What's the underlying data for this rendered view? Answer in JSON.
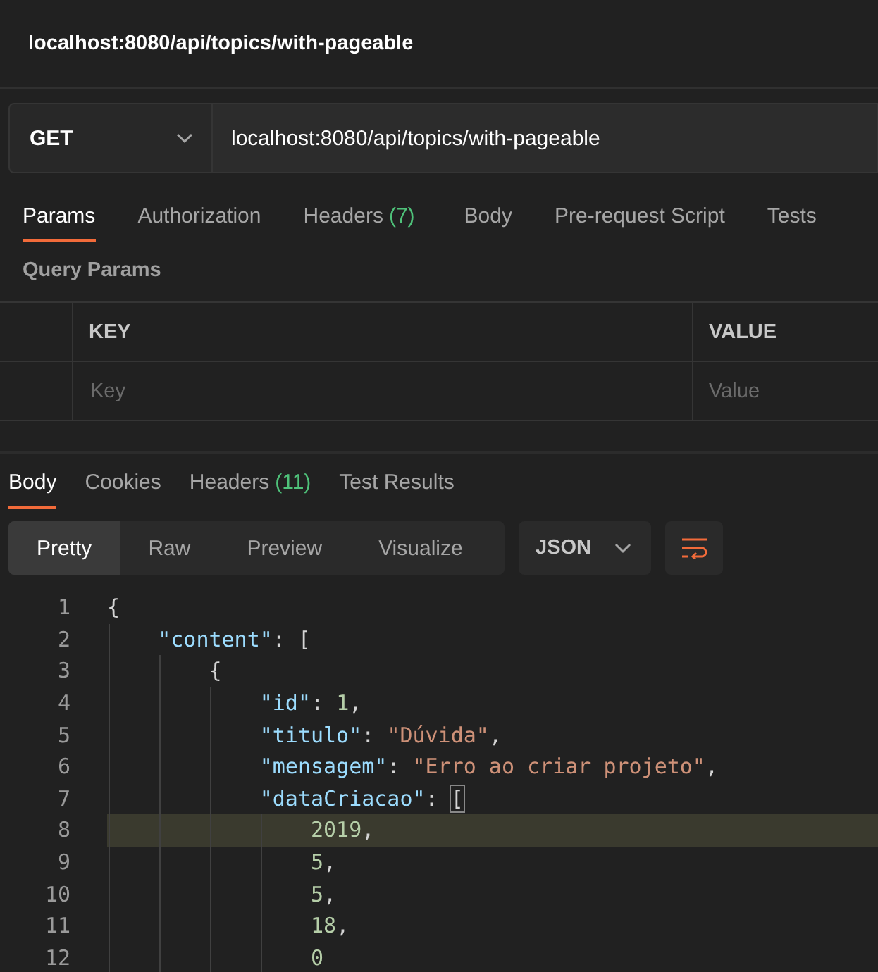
{
  "title": "localhost:8080/api/topics/with-pageable",
  "request": {
    "method": "GET",
    "url": "localhost:8080/api/topics/with-pageable"
  },
  "request_tabs": [
    {
      "label": "Params",
      "selected": true
    },
    {
      "label": "Authorization",
      "selected": false
    },
    {
      "label": "Headers",
      "count": "(7)",
      "selected": false
    },
    {
      "label": "Body",
      "selected": false
    },
    {
      "label": "Pre-request Script",
      "selected": false
    },
    {
      "label": "Tests",
      "selected": false
    }
  ],
  "query_params": {
    "heading": "Query Params",
    "columns": [
      "KEY",
      "VALUE"
    ],
    "placeholders": [
      "Key",
      "Value"
    ]
  },
  "response_tabs": [
    {
      "label": "Body",
      "selected": true
    },
    {
      "label": "Cookies",
      "selected": false
    },
    {
      "label": "Headers",
      "count": "(11)",
      "selected": false
    },
    {
      "label": "Test Results",
      "selected": false
    }
  ],
  "view_modes": [
    {
      "label": "Pretty",
      "selected": true
    },
    {
      "label": "Raw",
      "selected": false
    },
    {
      "label": "Preview",
      "selected": false
    },
    {
      "label": "Visualize",
      "selected": false
    }
  ],
  "format": "JSON",
  "code": [
    {
      "number": "1",
      "highlighted": false,
      "tokens": [
        {
          "kind": "punct",
          "text": "{"
        }
      ]
    },
    {
      "number": "2",
      "highlighted": false,
      "tokens": [
        {
          "kind": "key",
          "text": "    \"content\""
        },
        {
          "kind": "punct",
          "text": ": ["
        }
      ]
    },
    {
      "number": "3",
      "highlighted": false,
      "tokens": [
        {
          "kind": "punct",
          "text": "        {"
        }
      ]
    },
    {
      "number": "4",
      "highlighted": false,
      "tokens": [
        {
          "kind": "key",
          "text": "            \"id\""
        },
        {
          "kind": "punct",
          "text": ": "
        },
        {
          "kind": "number",
          "text": "1"
        },
        {
          "kind": "punct",
          "text": ","
        }
      ]
    },
    {
      "number": "5",
      "highlighted": false,
      "tokens": [
        {
          "kind": "key",
          "text": "            \"titulo\""
        },
        {
          "kind": "punct",
          "text": ": "
        },
        {
          "kind": "string",
          "text": "\"Dúvida\""
        },
        {
          "kind": "punct",
          "text": ","
        }
      ]
    },
    {
      "number": "6",
      "highlighted": false,
      "tokens": [
        {
          "kind": "key",
          "text": "            \"mensagem\""
        },
        {
          "kind": "punct",
          "text": ": "
        },
        {
          "kind": "string",
          "text": "\"Erro ao criar projeto\""
        },
        {
          "kind": "punct",
          "text": ","
        }
      ]
    },
    {
      "number": "7",
      "highlighted": false,
      "tokens": [
        {
          "kind": "key",
          "text": "            \"dataCriacao\""
        },
        {
          "kind": "punct",
          "text": ": "
        },
        {
          "kind": "match",
          "text": "["
        }
      ]
    },
    {
      "number": "8",
      "highlighted": true,
      "tokens": [
        {
          "kind": "number",
          "text": "                2019"
        },
        {
          "kind": "punct",
          "text": ","
        }
      ]
    },
    {
      "number": "9",
      "highlighted": false,
      "tokens": [
        {
          "kind": "number",
          "text": "                5"
        },
        {
          "kind": "punct",
          "text": ","
        }
      ]
    },
    {
      "number": "10",
      "highlighted": false,
      "tokens": [
        {
          "kind": "number",
          "text": "                5"
        },
        {
          "kind": "punct",
          "text": ","
        }
      ]
    },
    {
      "number": "11",
      "highlighted": false,
      "tokens": [
        {
          "kind": "number",
          "text": "                18"
        },
        {
          "kind": "punct",
          "text": ","
        }
      ]
    },
    {
      "number": "12",
      "highlighted": false,
      "tokens": [
        {
          "kind": "number",
          "text": "                0"
        }
      ]
    }
  ]
}
